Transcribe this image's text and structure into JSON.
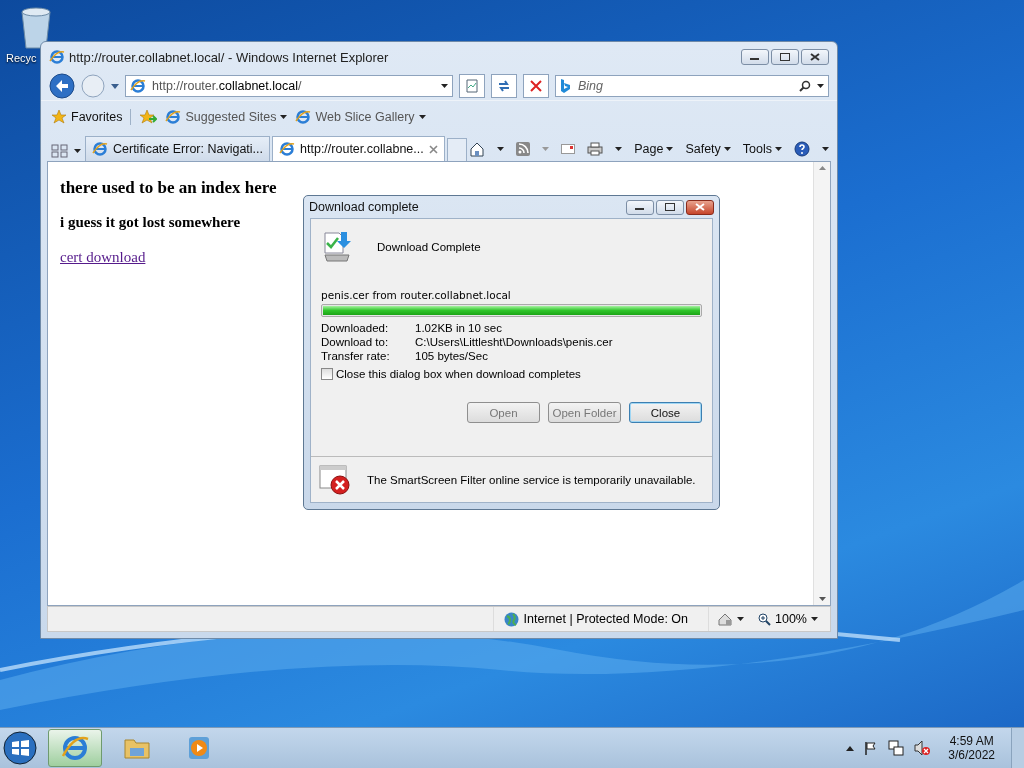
{
  "desktop": {
    "icons": [
      {
        "label": "Recyc"
      }
    ]
  },
  "browser": {
    "title": "http://router.collabnet.local/ - Windows Internet Explorer",
    "address": "http://router.**collabnet.local**/",
    "search": {
      "placeholder": "Bing"
    },
    "favorites": "Favorites",
    "links": [
      {
        "label": "Suggested Sites"
      },
      {
        "label": "Web Slice Gallery"
      }
    ],
    "tabs": [
      {
        "label": "Certificate Error: Navigati...",
        "selected": false
      },
      {
        "label": "http://router.collabne...",
        "selected": true
      }
    ],
    "commands": [
      "Page",
      "Safety",
      "Tools"
    ],
    "page": {
      "heading": "there used to be an index here",
      "subheading": "i guess it got lost somewhere",
      "link": "cert download"
    },
    "status_bar": {
      "zone": "Internet | Protected Mode: On",
      "zoom": "100%"
    }
  },
  "dialog": {
    "title": "Download complete",
    "heading": "Download Complete",
    "file": "penis.cer from router.collabnet.local",
    "level": 1,
    "details": [
      {
        "label": "Downloaded:",
        "value": "1.02KB in 10 sec"
      },
      {
        "label": "Download to:",
        "value": "C:\\Users\\Littlesht\\Downloads\\penis.cer"
      },
      {
        "label": "Transfer rate:",
        "value": "105 bytes/Sec"
      }
    ],
    "checkbox": {
      "label": "Close this dialog box when download completes",
      "checked": false
    },
    "buttons": [
      {
        "label": "Open",
        "default": false
      },
      {
        "label": "Open Folder",
        "default": false
      },
      {
        "label": "Close",
        "default": true
      }
    ],
    "notice": "The SmartScreen Filter online service is temporarily unavailable."
  },
  "taskbar": {
    "items": [
      {
        "kind": "browser",
        "active": true
      },
      {
        "kind": "folder",
        "active": false
      },
      {
        "kind": "media",
        "active": false
      }
    ],
    "time": "4:59 AM",
    "date": "3/6/2022"
  }
}
